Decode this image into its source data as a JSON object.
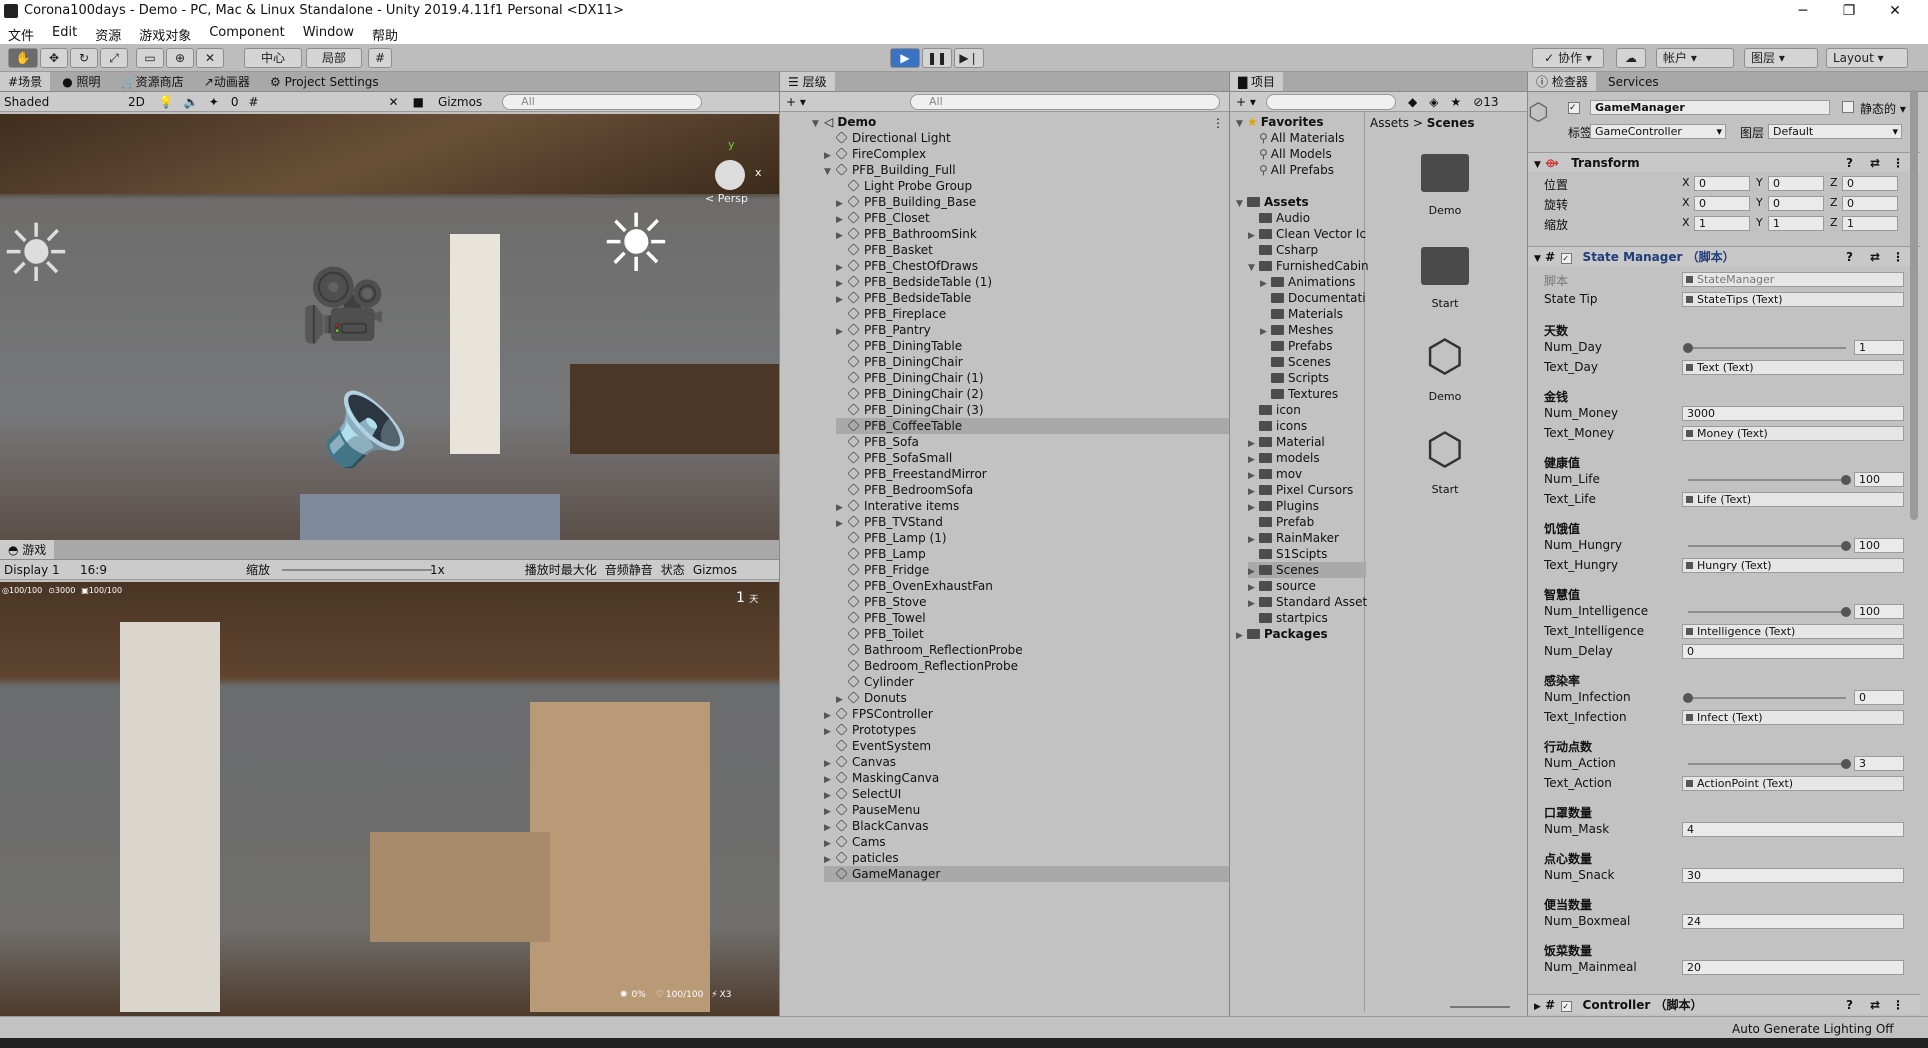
{
  "window": {
    "title": "Corona100days - Demo - PC, Mac & Linux Standalone - Unity 2019.4.11f1 Personal <DX11>",
    "minimize": "─",
    "maximize": "❐",
    "close": "✕"
  },
  "menu": [
    "文件",
    "Edit",
    "资源",
    "游戏对象",
    "Component",
    "Window",
    "帮助"
  ],
  "toolbar": {
    "pivot": "中心",
    "space": "局部",
    "collab": "协作",
    "account": "帐户",
    "layers": "图层",
    "layout": "Layout"
  },
  "scene": {
    "tabs": [
      "场景",
      "照明",
      "资源商店",
      "动画器",
      "Project Settings"
    ],
    "shading": "Shaded",
    "mode2d": "2D",
    "hidden": "0",
    "gizmos": "Gizmos",
    "search": "All",
    "persp": "< Persp",
    "axis_y": "y",
    "axis_x": "x"
  },
  "game": {
    "tab": "游戏",
    "display": "Display 1",
    "aspect": "16:9",
    "scale_label": "缩放",
    "scale_value": "1x",
    "maximize": "播放时最大化",
    "mute": "音频静音",
    "stats": "状态",
    "gizmos": "Gizmos",
    "hud_life": "100/100",
    "hud_money": "3000",
    "hud_hungry": "100/100",
    "day": "1",
    "day_unit": "天",
    "bottom_infect": "0%",
    "bottom_life": "100/100",
    "bottom_action": "X3"
  },
  "hierarchy": {
    "tab": "层级",
    "search": "All",
    "scene": "Demo",
    "items": [
      {
        "label": "Directional Light",
        "depth": 1,
        "arrow": ""
      },
      {
        "label": "FireComplex",
        "depth": 1,
        "arrow": "▶"
      },
      {
        "label": "PFB_Building_Full",
        "depth": 1,
        "arrow": "▼"
      },
      {
        "label": "Light Probe Group",
        "depth": 2,
        "arrow": ""
      },
      {
        "label": "PFB_Building_Base",
        "depth": 2,
        "arrow": "▶"
      },
      {
        "label": "PFB_Closet",
        "depth": 2,
        "arrow": "▶"
      },
      {
        "label": "PFB_BathroomSink",
        "depth": 2,
        "arrow": "▶"
      },
      {
        "label": "PFB_Basket",
        "depth": 2,
        "arrow": ""
      },
      {
        "label": "PFB_ChestOfDraws",
        "depth": 2,
        "arrow": "▶"
      },
      {
        "label": "PFB_BedsideTable (1)",
        "depth": 2,
        "arrow": "▶"
      },
      {
        "label": "PFB_BedsideTable",
        "depth": 2,
        "arrow": "▶"
      },
      {
        "label": "PFB_Fireplace",
        "depth": 2,
        "arrow": ""
      },
      {
        "label": "PFB_Pantry",
        "depth": 2,
        "arrow": "▶"
      },
      {
        "label": "PFB_DiningTable",
        "depth": 2,
        "arrow": ""
      },
      {
        "label": "PFB_DiningChair",
        "depth": 2,
        "arrow": ""
      },
      {
        "label": "PFB_DiningChair (1)",
        "depth": 2,
        "arrow": ""
      },
      {
        "label": "PFB_DiningChair (2)",
        "depth": 2,
        "arrow": ""
      },
      {
        "label": "PFB_DiningChair (3)",
        "depth": 2,
        "arrow": ""
      },
      {
        "label": "PFB_CoffeeTable",
        "depth": 2,
        "arrow": ""
      },
      {
        "label": "PFB_Sofa",
        "depth": 2,
        "arrow": ""
      },
      {
        "label": "PFB_SofaSmall",
        "depth": 2,
        "arrow": ""
      },
      {
        "label": "PFB_FreestandMirror",
        "depth": 2,
        "arrow": ""
      },
      {
        "label": "PFB_BedroomSofa",
        "depth": 2,
        "arrow": ""
      },
      {
        "label": "Interative items",
        "depth": 2,
        "arrow": "▶"
      },
      {
        "label": "PFB_TVStand",
        "depth": 2,
        "arrow": "▶"
      },
      {
        "label": "PFB_Lamp (1)",
        "depth": 2,
        "arrow": ""
      },
      {
        "label": "PFB_Lamp",
        "depth": 2,
        "arrow": ""
      },
      {
        "label": "PFB_Fridge",
        "depth": 2,
        "arrow": ""
      },
      {
        "label": "PFB_OvenExhaustFan",
        "depth": 2,
        "arrow": ""
      },
      {
        "label": "PFB_Stove",
        "depth": 2,
        "arrow": ""
      },
      {
        "label": "PFB_Towel",
        "depth": 2,
        "arrow": ""
      },
      {
        "label": "PFB_Toilet",
        "depth": 2,
        "arrow": ""
      },
      {
        "label": "Bathroom_ReflectionProbe",
        "depth": 2,
        "arrow": ""
      },
      {
        "label": "Bedroom_ReflectionProbe",
        "depth": 2,
        "arrow": ""
      },
      {
        "label": "Cylinder",
        "depth": 2,
        "arrow": ""
      },
      {
        "label": "Donuts",
        "depth": 2,
        "arrow": "▶"
      },
      {
        "label": "FPSController",
        "depth": 1,
        "arrow": "▶"
      },
      {
        "label": "Prototypes",
        "depth": 1,
        "arrow": "▶"
      },
      {
        "label": "EventSystem",
        "depth": 1,
        "arrow": ""
      },
      {
        "label": "Canvas",
        "depth": 1,
        "arrow": "▶"
      },
      {
        "label": "MaskingCanva",
        "depth": 1,
        "arrow": "▶"
      },
      {
        "label": "SelectUI",
        "depth": 1,
        "arrow": "▶"
      },
      {
        "label": "PauseMenu",
        "depth": 1,
        "arrow": "▶"
      },
      {
        "label": "BlackCanvas",
        "depth": 1,
        "arrow": "▶"
      },
      {
        "label": "Cams",
        "depth": 1,
        "arrow": "▶"
      },
      {
        "label": "paticles",
        "depth": 1,
        "arrow": "▶"
      },
      {
        "label": "GameManager",
        "depth": 1,
        "arrow": ""
      }
    ]
  },
  "project": {
    "tab": "项目",
    "count": "13",
    "breadcrumb": [
      "Assets",
      "Scenes"
    ],
    "tree": [
      {
        "label": "Favorites",
        "depth": 0,
        "arrow": "▼",
        "bold": true
      },
      {
        "label": "All Materials",
        "depth": 1,
        "arrow": ""
      },
      {
        "label": "All Models",
        "depth": 1,
        "arrow": ""
      },
      {
        "label": "All Prefabs",
        "depth": 1,
        "arrow": ""
      },
      {
        "label": "",
        "depth": 0,
        "arrow": ""
      },
      {
        "label": "Assets",
        "depth": 0,
        "arrow": "▼",
        "bold": true
      },
      {
        "label": "Audio",
        "depth": 1,
        "arrow": ""
      },
      {
        "label": "Clean Vector Ic",
        "depth": 1,
        "arrow": "▶"
      },
      {
        "label": "Csharp",
        "depth": 1,
        "arrow": ""
      },
      {
        "label": "FurnishedCabin",
        "depth": 1,
        "arrow": "▼"
      },
      {
        "label": "Animations",
        "depth": 2,
        "arrow": "▶"
      },
      {
        "label": "Documentati",
        "depth": 2,
        "arrow": ""
      },
      {
        "label": "Materials",
        "depth": 2,
        "arrow": ""
      },
      {
        "label": "Meshes",
        "depth": 2,
        "arrow": "▶"
      },
      {
        "label": "Prefabs",
        "depth": 2,
        "arrow": ""
      },
      {
        "label": "Scenes",
        "depth": 2,
        "arrow": ""
      },
      {
        "label": "Scripts",
        "depth": 2,
        "arrow": ""
      },
      {
        "label": "Textures",
        "depth": 2,
        "arrow": ""
      },
      {
        "label": "icon",
        "depth": 1,
        "arrow": ""
      },
      {
        "label": "icons",
        "depth": 1,
        "arrow": ""
      },
      {
        "label": "Material",
        "depth": 1,
        "arrow": "▶"
      },
      {
        "label": "models",
        "depth": 1,
        "arrow": "▶"
      },
      {
        "label": "mov",
        "depth": 1,
        "arrow": "▶"
      },
      {
        "label": "Pixel Cursors",
        "depth": 1,
        "arrow": "▶"
      },
      {
        "label": "Plugins",
        "depth": 1,
        "arrow": "▶"
      },
      {
        "label": "Prefab",
        "depth": 1,
        "arrow": ""
      },
      {
        "label": "RainMaker",
        "depth": 1,
        "arrow": "▶"
      },
      {
        "label": "S1Scipts",
        "depth": 1,
        "arrow": ""
      },
      {
        "label": "Scenes",
        "depth": 1,
        "arrow": "▶"
      },
      {
        "label": "source",
        "depth": 1,
        "arrow": "▶"
      },
      {
        "label": "Standard Asset",
        "depth": 1,
        "arrow": "▶"
      },
      {
        "label": "startpics",
        "depth": 1,
        "arrow": ""
      },
      {
        "label": "Packages",
        "depth": 0,
        "arrow": "▶",
        "bold": true
      }
    ],
    "assets": [
      {
        "label": "Demo",
        "kind": "folder"
      },
      {
        "label": "Start",
        "kind": "folder"
      },
      {
        "label": "Demo",
        "kind": "unity"
      },
      {
        "label": "Start",
        "kind": "unity"
      }
    ]
  },
  "inspector": {
    "tabs": [
      "检查器",
      "Services"
    ],
    "object_name": "GameManager",
    "static": "静态的",
    "tag_label": "标签",
    "tag": "GameController",
    "layer_label": "图层",
    "layer": "Default",
    "transform": {
      "title": "Transform",
      "rows": [
        {
          "label": "位置",
          "x": "0",
          "y": "0",
          "z": "0"
        },
        {
          "label": "旋转",
          "x": "0",
          "y": "0",
          "z": "0"
        },
        {
          "label": "缩放",
          "x": "1",
          "y": "1",
          "z": "1"
        }
      ]
    },
    "state_manager": {
      "title": "State Manager （脚本）",
      "script_label": "脚本",
      "script": "StateManager",
      "state_tip_label": "State Tip",
      "state_tip": "StateTips (Text)"
    },
    "groups": [
      {
        "header": "天数",
        "fields": [
          {
            "label": "Num_Day",
            "type": "slider",
            "value": "1",
            "fraction": 0
          },
          {
            "label": "Text_Day",
            "type": "obj",
            "value": "Text (Text)"
          }
        ]
      },
      {
        "header": "金钱",
        "fields": [
          {
            "label": "Num_Money",
            "type": "text",
            "value": "3000"
          },
          {
            "label": "Text_Money",
            "type": "obj",
            "value": "Money (Text)"
          }
        ]
      },
      {
        "header": "健康值",
        "fields": [
          {
            "label": "Num_Life",
            "type": "slider",
            "value": "100",
            "fraction": 1
          },
          {
            "label": "Text_Life",
            "type": "obj",
            "value": "Life (Text)"
          }
        ]
      },
      {
        "header": "饥饿值",
        "fields": [
          {
            "label": "Num_Hungry",
            "type": "slider",
            "value": "100",
            "fraction": 1
          },
          {
            "label": "Text_Hungry",
            "type": "obj",
            "value": "Hungry (Text)"
          }
        ]
      },
      {
        "header": "智慧值",
        "fields": [
          {
            "label": "Num_Intelligence",
            "type": "slider",
            "value": "100",
            "fraction": 1
          },
          {
            "label": "Text_Intelligence",
            "type": "obj",
            "value": "Intelligence (Text)"
          },
          {
            "label": "Num_Delay",
            "type": "text",
            "value": "0"
          }
        ]
      },
      {
        "header": "感染率",
        "fields": [
          {
            "label": "Num_Infection",
            "type": "slider",
            "value": "0",
            "fraction": 0
          },
          {
            "label": "Text_Infection",
            "type": "obj",
            "value": "Infect (Text)"
          }
        ]
      },
      {
        "header": "行动点数",
        "fields": [
          {
            "label": "Num_Action",
            "type": "slider",
            "value": "3",
            "fraction": 1
          },
          {
            "label": "Text_Action",
            "type": "obj",
            "value": "ActionPoint (Text)"
          }
        ]
      },
      {
        "header": "口罩数量",
        "fields": [
          {
            "label": "Num_Mask",
            "type": "text",
            "value": "4"
          }
        ]
      },
      {
        "header": "点心数量",
        "fields": [
          {
            "label": "Num_Snack",
            "type": "text",
            "value": "30"
          }
        ]
      },
      {
        "header": "便当数量",
        "fields": [
          {
            "label": "Num_Boxmeal",
            "type": "text",
            "value": "24"
          }
        ]
      },
      {
        "header": "饭菜数量",
        "fields": [
          {
            "label": "Num_Mainmeal",
            "type": "text",
            "value": "20"
          }
        ]
      }
    ],
    "controller": "Controller （脚本）"
  },
  "status": {
    "text": "Auto Generate Lighting Off"
  }
}
